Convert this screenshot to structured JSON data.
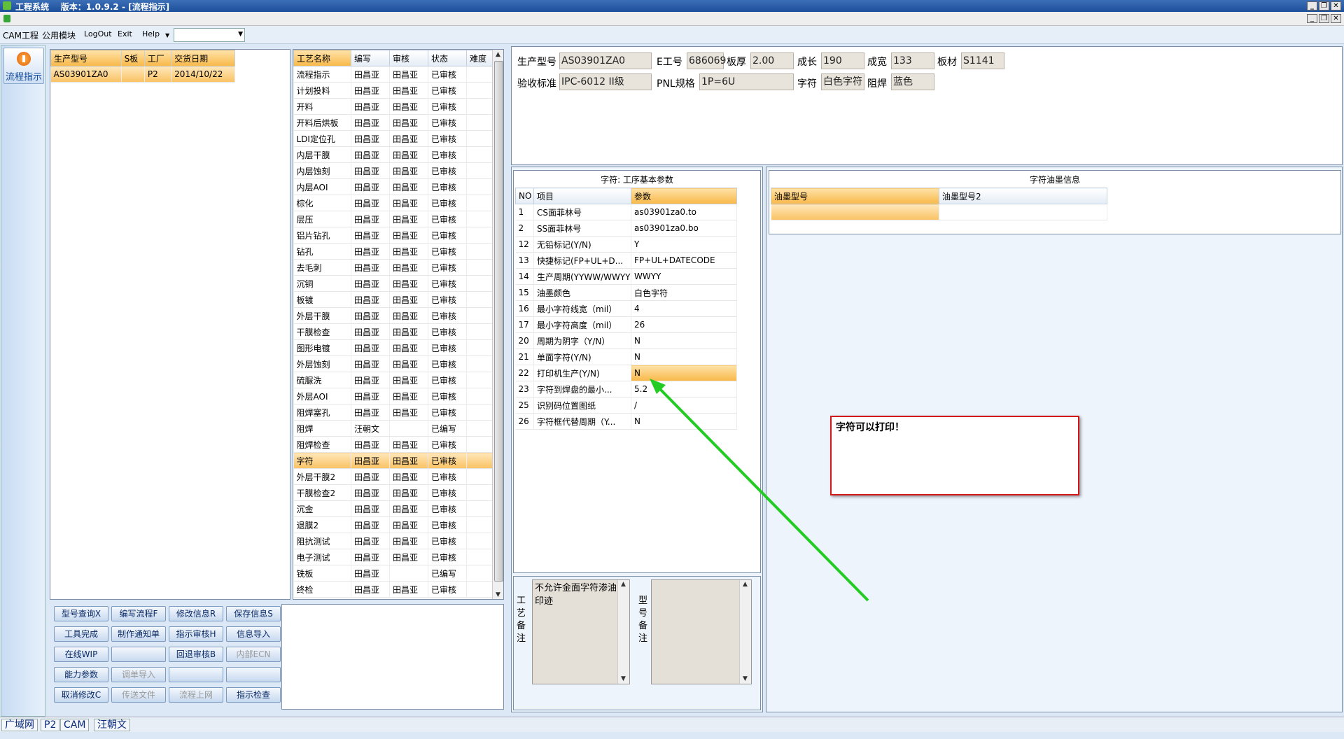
{
  "window": {
    "title": "工程系统    版本：1.0.9.2 - [流程指示]"
  },
  "menu": {
    "items": [
      "CAM工程",
      "公用模块",
      "LogOut",
      "Exit",
      "Help"
    ],
    "combo_value": ""
  },
  "nav": {
    "button_label": "流程指示"
  },
  "order_table": {
    "headers": [
      "生产型号",
      "S板",
      "工厂",
      "交货日期"
    ],
    "rows": [
      [
        "AS03901ZA0",
        "",
        "P2",
        "2014/10/22"
      ]
    ]
  },
  "process_table": {
    "headers": [
      "工艺名称",
      "编写",
      "审核",
      "状态",
      "难度"
    ],
    "selected_index": 24,
    "rows": [
      [
        "流程指示",
        "田昌亚",
        "田昌亚",
        "已审核",
        ""
      ],
      [
        "计划投料",
        "田昌亚",
        "田昌亚",
        "已审核",
        ""
      ],
      [
        "开料",
        "田昌亚",
        "田昌亚",
        "已审核",
        ""
      ],
      [
        "开料后烘板",
        "田昌亚",
        "田昌亚",
        "已审核",
        ""
      ],
      [
        "LDI定位孔",
        "田昌亚",
        "田昌亚",
        "已审核",
        ""
      ],
      [
        "内层干膜",
        "田昌亚",
        "田昌亚",
        "已审核",
        ""
      ],
      [
        "内层蚀刻",
        "田昌亚",
        "田昌亚",
        "已审核",
        ""
      ],
      [
        "内层AOI",
        "田昌亚",
        "田昌亚",
        "已审核",
        ""
      ],
      [
        "棕化",
        "田昌亚",
        "田昌亚",
        "已审核",
        ""
      ],
      [
        "层压",
        "田昌亚",
        "田昌亚",
        "已审核",
        ""
      ],
      [
        "铝片钻孔",
        "田昌亚",
        "田昌亚",
        "已审核",
        ""
      ],
      [
        "钻孔",
        "田昌亚",
        "田昌亚",
        "已审核",
        ""
      ],
      [
        "去毛刺",
        "田昌亚",
        "田昌亚",
        "已审核",
        ""
      ],
      [
        "沉铜",
        "田昌亚",
        "田昌亚",
        "已审核",
        ""
      ],
      [
        "板镀",
        "田昌亚",
        "田昌亚",
        "已审核",
        ""
      ],
      [
        "外层干膜",
        "田昌亚",
        "田昌亚",
        "已审核",
        ""
      ],
      [
        "干膜检查",
        "田昌亚",
        "田昌亚",
        "已审核",
        ""
      ],
      [
        "图形电镀",
        "田昌亚",
        "田昌亚",
        "已审核",
        ""
      ],
      [
        "外层蚀刻",
        "田昌亚",
        "田昌亚",
        "已审核",
        ""
      ],
      [
        "硫脲洗",
        "田昌亚",
        "田昌亚",
        "已审核",
        ""
      ],
      [
        "外层AOI",
        "田昌亚",
        "田昌亚",
        "已审核",
        ""
      ],
      [
        "阻焊塞孔",
        "田昌亚",
        "田昌亚",
        "已审核",
        ""
      ],
      [
        "阻焊",
        "汪朝文",
        "",
        "已编写",
        ""
      ],
      [
        "阻焊检查",
        "田昌亚",
        "田昌亚",
        "已审核",
        ""
      ],
      [
        "字符",
        "田昌亚",
        "田昌亚",
        "已审核",
        ""
      ],
      [
        "外层干膜2",
        "田昌亚",
        "田昌亚",
        "已审核",
        ""
      ],
      [
        "干膜检查2",
        "田昌亚",
        "田昌亚",
        "已审核",
        ""
      ],
      [
        "沉金",
        "田昌亚",
        "田昌亚",
        "已审核",
        ""
      ],
      [
        "退膜2",
        "田昌亚",
        "田昌亚",
        "已审核",
        ""
      ],
      [
        "阻抗测试",
        "田昌亚",
        "田昌亚",
        "已审核",
        ""
      ],
      [
        "电子测试",
        "田昌亚",
        "田昌亚",
        "已审核",
        ""
      ],
      [
        "铣板",
        "田昌亚",
        "",
        "已编写",
        ""
      ],
      [
        "终检",
        "田昌亚",
        "田昌亚",
        "已审核",
        ""
      ]
    ]
  },
  "actions": [
    [
      "型号查询X",
      "编写流程F",
      "修改信息R",
      "保存信息S"
    ],
    [
      "工具完成",
      "制作通知单",
      "指示审核H",
      "信息导入"
    ],
    [
      "在线WIP",
      "",
      "回退审核B",
      "内部ECN"
    ],
    [
      "能力参数",
      "调单导入",
      "",
      ""
    ],
    [
      "取消修改C",
      "传送文件",
      "流程上网",
      "指示检查"
    ]
  ],
  "actions_disabled": [
    "调单导入",
    "传送文件",
    "流程上网",
    "内部ECN"
  ],
  "info": {
    "model_label": "生产型号",
    "model": "AS03901ZA0",
    "e_label": "E工号",
    "e_no": "686069",
    "thick_label": "板厚",
    "thickness": "2.00",
    "len_label": "成长",
    "length": "190",
    "wid_label": "成宽",
    "width": "133",
    "mat_label": "板材",
    "material": "S1141",
    "std_label": "验收标准",
    "standard": "IPC-6012 II级",
    "pnl_label": "PNL规格",
    "pnl": "1P=6U",
    "char_label": "字符",
    "char_color": "白色字符",
    "mask_label": "阻焊",
    "mask_color": "蓝色"
  },
  "params": {
    "title": "字符: 工序基本参数",
    "headers": [
      "NO",
      "项目",
      "参数"
    ],
    "selected_index": 10,
    "rows": [
      [
        "1",
        "CS面菲林号",
        "as03901za0.to"
      ],
      [
        "2",
        "SS面菲林号",
        "as03901za0.bo"
      ],
      [
        "12",
        "无铅标记(Y/N)",
        "Y"
      ],
      [
        "13",
        "快捷标记(FP+UL+D...",
        "FP+UL+DATECODE"
      ],
      [
        "14",
        "生产周期(YYWW/WWYY)",
        "WWYY"
      ],
      [
        "15",
        "油墨颜色",
        "白色字符"
      ],
      [
        "16",
        "最小字符线宽（mil）",
        "4"
      ],
      [
        "17",
        "最小字符高度（mil）",
        "26"
      ],
      [
        "20",
        "周期为阴字（Y/N）",
        "N"
      ],
      [
        "21",
        "单面字符(Y/N)",
        "N"
      ],
      [
        "22",
        "打印机生产(Y/N)",
        "N"
      ],
      [
        "23",
        "字符到焊盘的最小...",
        "5.2"
      ],
      [
        "25",
        "识别码位置图纸",
        "/"
      ],
      [
        "26",
        "字符框代替周期（Y...",
        "N"
      ]
    ]
  },
  "ink": {
    "title": "字符油墨信息",
    "headers": [
      "油墨型号",
      "油墨型号2"
    ]
  },
  "remarks": {
    "process_label": "工艺备注",
    "process_text": "不允许金面字符渗油印迹",
    "model_label": "型号备注",
    "model_text": ""
  },
  "annotation": {
    "text": "字符可以打印！"
  },
  "status": [
    "广域网",
    "P2",
    "CAM",
    "汪朝文"
  ],
  "colors": {
    "accent_orange": "#f8b848",
    "annotation_border": "#d01818",
    "arrow": "#22cc22"
  }
}
